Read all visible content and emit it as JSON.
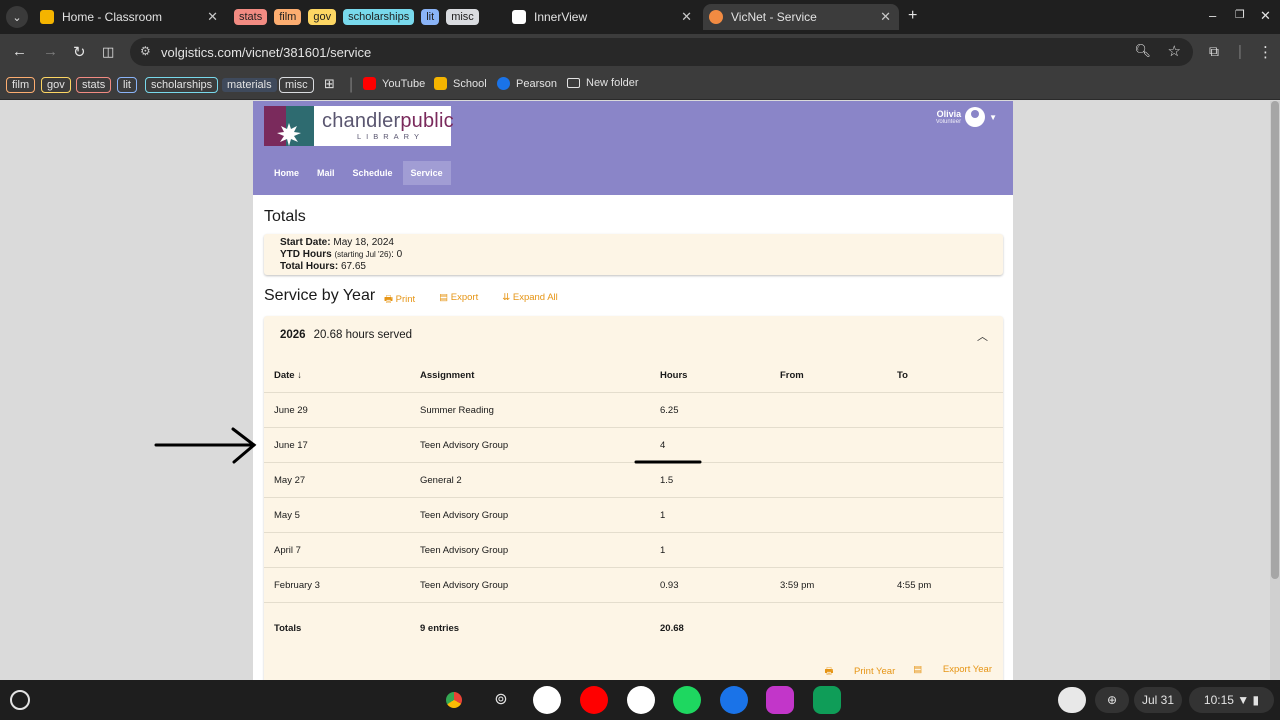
{
  "browser": {
    "tabs": [
      {
        "title": "Home - Classroom",
        "active": false
      },
      {
        "title": "InnerView",
        "active": false
      },
      {
        "title": "VicNet - Service",
        "active": true
      }
    ],
    "tab_groups": [
      "stats",
      "film",
      "gov",
      "scholarships",
      "lit",
      "misc"
    ],
    "url": "volgistics.com/vicnet/381601/service",
    "bookmark_groups": [
      "film",
      "gov",
      "stats",
      "lit",
      "scholarships",
      "materials",
      "misc"
    ],
    "bookmarks": [
      "YouTube",
      "School",
      "Pearson",
      "New folder"
    ]
  },
  "site": {
    "logo_name_part1": "chandler",
    "logo_name_part2": "public",
    "logo_sub": "LIBRARY",
    "user_name": "Olivia",
    "user_role": "Volunteer",
    "nav": [
      "Home",
      "Mail",
      "Schedule",
      "Service"
    ],
    "active_nav": "Service"
  },
  "totals": {
    "title": "Totals",
    "start_date_label": "Start Date:",
    "start_date": "May 18, 2024",
    "ytd_label": "YTD Hours",
    "ytd_note": "(starting Jul '26)",
    "ytd_value": ": 0",
    "total_label": "Total Hours:",
    "total_value": "67.65"
  },
  "service_by_year": {
    "title": "Service by Year",
    "print": "Print",
    "export": "Export",
    "expand_all": "Expand All",
    "year": "2026",
    "year_summary": "20.68 hours served",
    "columns": [
      "Date",
      "Assignment",
      "Hours",
      "From",
      "To"
    ],
    "rows": [
      {
        "date": "June 29",
        "assignment": "Summer Reading",
        "hours": "6.25",
        "from": "",
        "to": ""
      },
      {
        "date": "June 17",
        "assignment": "Teen Advisory Group",
        "hours": "4",
        "from": "",
        "to": ""
      },
      {
        "date": "May 27",
        "assignment": "General 2",
        "hours": "1.5",
        "from": "",
        "to": ""
      },
      {
        "date": "May 5",
        "assignment": "Teen Advisory Group",
        "hours": "1",
        "from": "",
        "to": ""
      },
      {
        "date": "April 7",
        "assignment": "Teen Advisory Group",
        "hours": "1",
        "from": "",
        "to": ""
      },
      {
        "date": "February 3",
        "assignment": "Teen Advisory Group",
        "hours": "0.93",
        "from": "3:59 pm",
        "to": "4:55 pm"
      }
    ],
    "totals_label": "Totals",
    "totals_entries": "9 entries",
    "totals_hours": "20.68",
    "print_year": "Print Year",
    "export_year": "Export Year"
  },
  "shelf": {
    "date": "Jul 31",
    "time": "10:15"
  }
}
